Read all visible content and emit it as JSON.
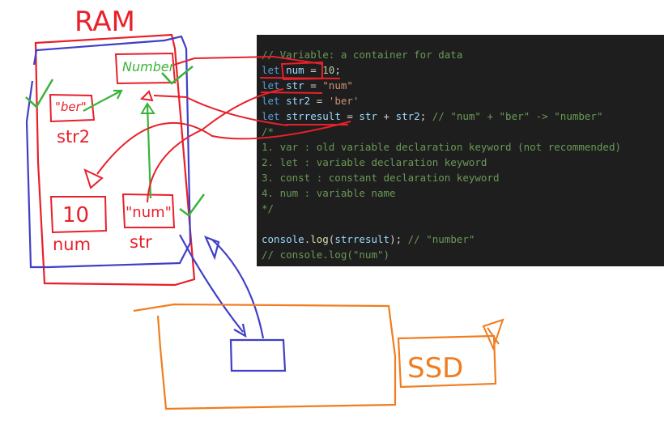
{
  "code": {
    "lines": [
      [
        {
          "t": "comment",
          "v": "// Variable: a container for data"
        }
      ],
      [
        {
          "t": "keyword",
          "v": "let "
        },
        {
          "t": "var",
          "v": "num"
        },
        {
          "t": "plain",
          "v": " = "
        },
        {
          "t": "number",
          "v": "10"
        },
        {
          "t": "plain",
          "v": ";"
        }
      ],
      [
        {
          "t": "keyword",
          "v": "let "
        },
        {
          "t": "var",
          "v": "str"
        },
        {
          "t": "plain",
          "v": " = "
        },
        {
          "t": "string",
          "v": "\"num\""
        }
      ],
      [
        {
          "t": "keyword",
          "v": "let "
        },
        {
          "t": "var",
          "v": "str2"
        },
        {
          "t": "plain",
          "v": " = "
        },
        {
          "t": "string",
          "v": "'ber'"
        }
      ],
      [
        {
          "t": "keyword",
          "v": "let "
        },
        {
          "t": "var",
          "v": "strresult"
        },
        {
          "t": "plain",
          "v": " = "
        },
        {
          "t": "var",
          "v": "str"
        },
        {
          "t": "plain",
          "v": " + "
        },
        {
          "t": "var",
          "v": "str2"
        },
        {
          "t": "plain",
          "v": "; "
        },
        {
          "t": "comment",
          "v": "// \"num\" + \"ber\" -> \"number\""
        }
      ],
      [
        {
          "t": "comment",
          "v": "/*"
        }
      ],
      [
        {
          "t": "comment",
          "v": "1. var : old variable declaration keyword (not recommended)"
        }
      ],
      [
        {
          "t": "comment",
          "v": "2. let : variable declaration keyword"
        }
      ],
      [
        {
          "t": "comment",
          "v": "3. const : constant declaration keyword"
        }
      ],
      [
        {
          "t": "comment",
          "v": "4. num : variable name"
        }
      ],
      [
        {
          "t": "comment",
          "v": "*/"
        }
      ],
      [
        {
          "t": "plain",
          "v": ""
        }
      ],
      [
        {
          "t": "var",
          "v": "console"
        },
        {
          "t": "plain",
          "v": "."
        },
        {
          "t": "fn",
          "v": "log"
        },
        {
          "t": "plain",
          "v": "("
        },
        {
          "t": "var",
          "v": "strresult"
        },
        {
          "t": "plain",
          "v": "); "
        },
        {
          "t": "comment",
          "v": "// \"number\""
        }
      ],
      [
        {
          "t": "comment",
          "v": "// console.log(\"num\")"
        }
      ]
    ]
  },
  "sketch": {
    "ram_label": "RAM",
    "ssd_label": "SSD",
    "box_number_value": "Number",
    "box_ber_value": "\"ber\"",
    "box_ber_name": "str2",
    "box_10_value": "10",
    "box_10_name": "num",
    "box_num_value": "\"num\"",
    "box_num_name": "str",
    "colors": {
      "red": "#e8202a",
      "blue": "#3f3fc8",
      "green": "#3bb33b",
      "orange": "#f07d1f"
    }
  }
}
